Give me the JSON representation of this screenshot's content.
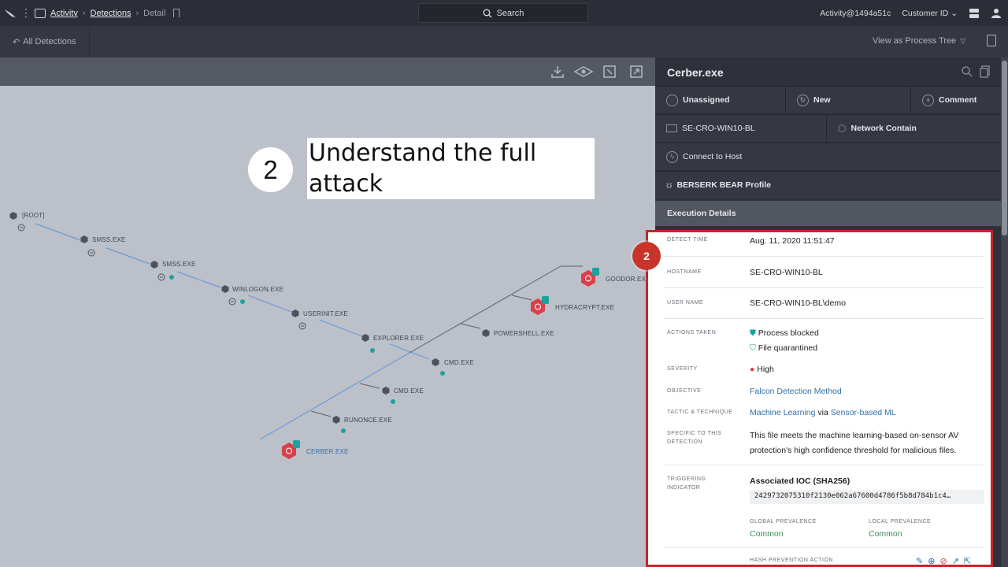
{
  "topbar": {
    "breadcrumb": [
      "Activity",
      "Detections",
      "Detail"
    ],
    "search_label": "Search",
    "account": "Activity@1494a51c",
    "customer_id": "Customer ID"
  },
  "subbar": {
    "back_label": "All Detections",
    "view_as": "View as Process Tree"
  },
  "callout": {
    "number": "2",
    "text_line1": "Understand the full",
    "text_line2": "attack"
  },
  "graph": {
    "nodes": [
      {
        "label": "[ROOT]"
      },
      {
        "label": "SMSS.EXE"
      },
      {
        "label": "SMSS.EXE"
      },
      {
        "label": "WINLOGON.EXE"
      },
      {
        "label": "USERINIT.EXE"
      },
      {
        "label": "EXPLORER.EXE"
      },
      {
        "label": "CMD.EXE"
      },
      {
        "label": "CMD.EXE"
      },
      {
        "label": "RUNONCE.EXE"
      },
      {
        "label": "CERBER.EXE"
      },
      {
        "label": "POWERSHELL.EXE"
      },
      {
        "label": "HYDRACRYPT.EXE"
      },
      {
        "label": "GOODOR.EXE"
      }
    ]
  },
  "panel": {
    "title": "Cerber.exe",
    "assign": "Unassigned",
    "status": "New",
    "comment": "Comment",
    "host": "SE-CRO-WIN10-BL",
    "network_contain": "Network Contain",
    "connect": "Connect to Host",
    "profile": "BERSERK BEAR Profile",
    "exec_header": "Execution Details"
  },
  "details": {
    "badge": "2",
    "detect_time_label": "DETECT TIME",
    "detect_time": "Aug. 11, 2020 11:51:47",
    "hostname_label": "HOSTNAME",
    "hostname": "SE-CRO-WIN10-BL",
    "username_label": "USER NAME",
    "username": "SE-CRO-WIN10-BL\\demo",
    "actions_label": "ACTIONS TAKEN",
    "action1": "Process blocked",
    "action2": "File quarantined",
    "severity_label": "SEVERITY",
    "severity": "High",
    "objective_label": "OBJECTIVE",
    "objective": "Falcon Detection Method",
    "tactic_label": "TACTIC & TECHNIQUE",
    "tactic": "Machine Learning",
    "tactic_via": "via",
    "technique": "Sensor-based ML",
    "specific_label_1": "SPECIFIC TO THIS",
    "specific_label_2": "DETECTION",
    "specific_line1": "This file meets the machine learning-based on-sensor AV",
    "specific_line2": "protection's high confidence threshold for malicious files.",
    "triggering_label_1": "TRIGGERING",
    "triggering_label_2": "INDICATOR",
    "ioc_title": "Associated IOC (SHA256)",
    "ioc_hash": "2429732075310f2130e062a67600d4786f5b8d784b1c4…",
    "global_prev_label": "GLOBAL PREVALENCE",
    "global_prev": "Common",
    "local_prev_label": "LOCAL PREVALENCE",
    "local_prev": "Common",
    "hash_prev_label": "HASH PREVENTION ACTION"
  },
  "colors": {
    "accent_red": "#c2272d",
    "link_blue": "#2f6fa8",
    "prevalence_green": "#3b8f5a",
    "malicious_node": "#d9404b",
    "teal_dot": "#1ba39c"
  }
}
